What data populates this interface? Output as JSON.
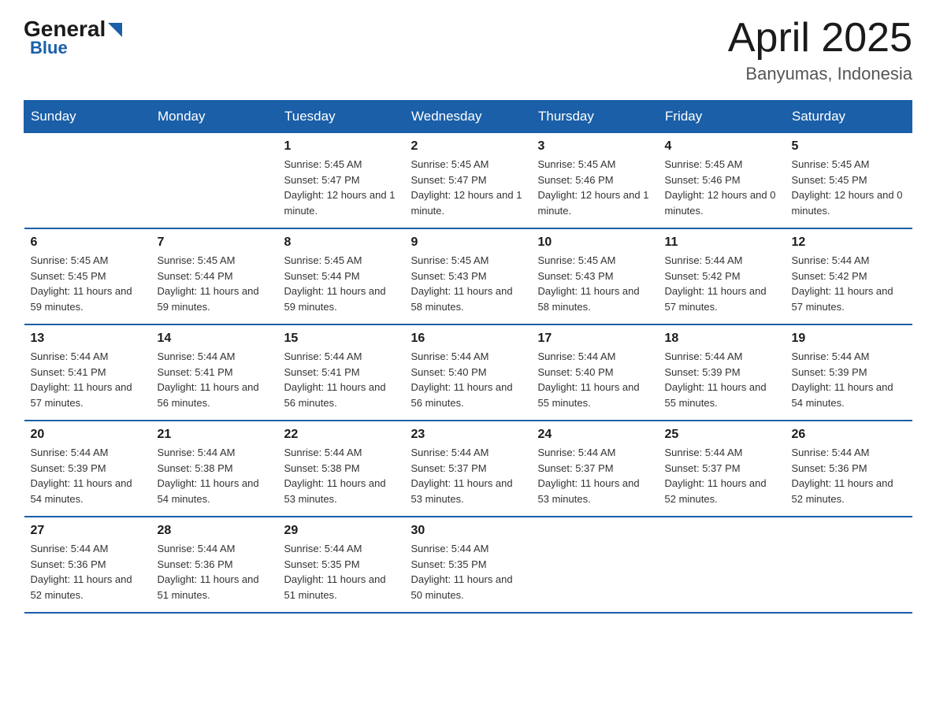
{
  "header": {
    "logo_general": "General",
    "logo_blue": "Blue",
    "month_title": "April 2025",
    "location": "Banyumas, Indonesia"
  },
  "weekdays": [
    "Sunday",
    "Monday",
    "Tuesday",
    "Wednesday",
    "Thursday",
    "Friday",
    "Saturday"
  ],
  "weeks": [
    [
      {
        "day": "",
        "sunrise": "",
        "sunset": "",
        "daylight": ""
      },
      {
        "day": "",
        "sunrise": "",
        "sunset": "",
        "daylight": ""
      },
      {
        "day": "1",
        "sunrise": "Sunrise: 5:45 AM",
        "sunset": "Sunset: 5:47 PM",
        "daylight": "Daylight: 12 hours and 1 minute."
      },
      {
        "day": "2",
        "sunrise": "Sunrise: 5:45 AM",
        "sunset": "Sunset: 5:47 PM",
        "daylight": "Daylight: 12 hours and 1 minute."
      },
      {
        "day": "3",
        "sunrise": "Sunrise: 5:45 AM",
        "sunset": "Sunset: 5:46 PM",
        "daylight": "Daylight: 12 hours and 1 minute."
      },
      {
        "day": "4",
        "sunrise": "Sunrise: 5:45 AM",
        "sunset": "Sunset: 5:46 PM",
        "daylight": "Daylight: 12 hours and 0 minutes."
      },
      {
        "day": "5",
        "sunrise": "Sunrise: 5:45 AM",
        "sunset": "Sunset: 5:45 PM",
        "daylight": "Daylight: 12 hours and 0 minutes."
      }
    ],
    [
      {
        "day": "6",
        "sunrise": "Sunrise: 5:45 AM",
        "sunset": "Sunset: 5:45 PM",
        "daylight": "Daylight: 11 hours and 59 minutes."
      },
      {
        "day": "7",
        "sunrise": "Sunrise: 5:45 AM",
        "sunset": "Sunset: 5:44 PM",
        "daylight": "Daylight: 11 hours and 59 minutes."
      },
      {
        "day": "8",
        "sunrise": "Sunrise: 5:45 AM",
        "sunset": "Sunset: 5:44 PM",
        "daylight": "Daylight: 11 hours and 59 minutes."
      },
      {
        "day": "9",
        "sunrise": "Sunrise: 5:45 AM",
        "sunset": "Sunset: 5:43 PM",
        "daylight": "Daylight: 11 hours and 58 minutes."
      },
      {
        "day": "10",
        "sunrise": "Sunrise: 5:45 AM",
        "sunset": "Sunset: 5:43 PM",
        "daylight": "Daylight: 11 hours and 58 minutes."
      },
      {
        "day": "11",
        "sunrise": "Sunrise: 5:44 AM",
        "sunset": "Sunset: 5:42 PM",
        "daylight": "Daylight: 11 hours and 57 minutes."
      },
      {
        "day": "12",
        "sunrise": "Sunrise: 5:44 AM",
        "sunset": "Sunset: 5:42 PM",
        "daylight": "Daylight: 11 hours and 57 minutes."
      }
    ],
    [
      {
        "day": "13",
        "sunrise": "Sunrise: 5:44 AM",
        "sunset": "Sunset: 5:41 PM",
        "daylight": "Daylight: 11 hours and 57 minutes."
      },
      {
        "day": "14",
        "sunrise": "Sunrise: 5:44 AM",
        "sunset": "Sunset: 5:41 PM",
        "daylight": "Daylight: 11 hours and 56 minutes."
      },
      {
        "day": "15",
        "sunrise": "Sunrise: 5:44 AM",
        "sunset": "Sunset: 5:41 PM",
        "daylight": "Daylight: 11 hours and 56 minutes."
      },
      {
        "day": "16",
        "sunrise": "Sunrise: 5:44 AM",
        "sunset": "Sunset: 5:40 PM",
        "daylight": "Daylight: 11 hours and 56 minutes."
      },
      {
        "day": "17",
        "sunrise": "Sunrise: 5:44 AM",
        "sunset": "Sunset: 5:40 PM",
        "daylight": "Daylight: 11 hours and 55 minutes."
      },
      {
        "day": "18",
        "sunrise": "Sunrise: 5:44 AM",
        "sunset": "Sunset: 5:39 PM",
        "daylight": "Daylight: 11 hours and 55 minutes."
      },
      {
        "day": "19",
        "sunrise": "Sunrise: 5:44 AM",
        "sunset": "Sunset: 5:39 PM",
        "daylight": "Daylight: 11 hours and 54 minutes."
      }
    ],
    [
      {
        "day": "20",
        "sunrise": "Sunrise: 5:44 AM",
        "sunset": "Sunset: 5:39 PM",
        "daylight": "Daylight: 11 hours and 54 minutes."
      },
      {
        "day": "21",
        "sunrise": "Sunrise: 5:44 AM",
        "sunset": "Sunset: 5:38 PM",
        "daylight": "Daylight: 11 hours and 54 minutes."
      },
      {
        "day": "22",
        "sunrise": "Sunrise: 5:44 AM",
        "sunset": "Sunset: 5:38 PM",
        "daylight": "Daylight: 11 hours and 53 minutes."
      },
      {
        "day": "23",
        "sunrise": "Sunrise: 5:44 AM",
        "sunset": "Sunset: 5:37 PM",
        "daylight": "Daylight: 11 hours and 53 minutes."
      },
      {
        "day": "24",
        "sunrise": "Sunrise: 5:44 AM",
        "sunset": "Sunset: 5:37 PM",
        "daylight": "Daylight: 11 hours and 53 minutes."
      },
      {
        "day": "25",
        "sunrise": "Sunrise: 5:44 AM",
        "sunset": "Sunset: 5:37 PM",
        "daylight": "Daylight: 11 hours and 52 minutes."
      },
      {
        "day": "26",
        "sunrise": "Sunrise: 5:44 AM",
        "sunset": "Sunset: 5:36 PM",
        "daylight": "Daylight: 11 hours and 52 minutes."
      }
    ],
    [
      {
        "day": "27",
        "sunrise": "Sunrise: 5:44 AM",
        "sunset": "Sunset: 5:36 PM",
        "daylight": "Daylight: 11 hours and 52 minutes."
      },
      {
        "day": "28",
        "sunrise": "Sunrise: 5:44 AM",
        "sunset": "Sunset: 5:36 PM",
        "daylight": "Daylight: 11 hours and 51 minutes."
      },
      {
        "day": "29",
        "sunrise": "Sunrise: 5:44 AM",
        "sunset": "Sunset: 5:35 PM",
        "daylight": "Daylight: 11 hours and 51 minutes."
      },
      {
        "day": "30",
        "sunrise": "Sunrise: 5:44 AM",
        "sunset": "Sunset: 5:35 PM",
        "daylight": "Daylight: 11 hours and 50 minutes."
      },
      {
        "day": "",
        "sunrise": "",
        "sunset": "",
        "daylight": ""
      },
      {
        "day": "",
        "sunrise": "",
        "sunset": "",
        "daylight": ""
      },
      {
        "day": "",
        "sunrise": "",
        "sunset": "",
        "daylight": ""
      }
    ]
  ]
}
